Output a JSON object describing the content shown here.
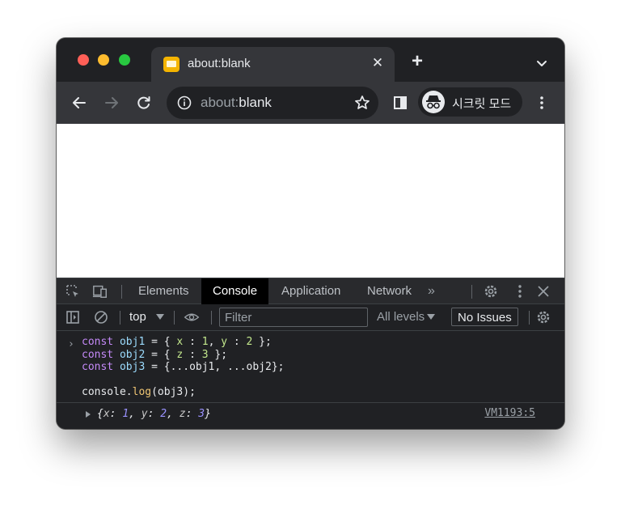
{
  "tab": {
    "title": "about:blank",
    "close_glyph": "✕",
    "new_tab_glyph": "+"
  },
  "omnibox": {
    "scheme": "about:",
    "host": "blank"
  },
  "profile": {
    "label": "시크릿 모드"
  },
  "devtools": {
    "tabs": [
      "Elements",
      "Console",
      "Application",
      "Network"
    ],
    "active_tab": "Console",
    "more_glyph": "»",
    "context": "top",
    "filter_placeholder": "Filter",
    "levels": "All levels",
    "issues": "No Issues"
  },
  "console": {
    "input_lines": [
      "const obj1 = { x : 1, y : 2 };",
      "const obj2 = { z : 3 };",
      "const obj3 = {...obj1, ...obj2};",
      "",
      "console.log(obj3);"
    ],
    "output": "{x: 1, y: 2, z: 3}",
    "source_link": "VM1193:5"
  },
  "colors": {
    "keyword": "#c58af9",
    "variable": "#9cdcfe",
    "number": "#c3e88d",
    "page_background": "#ffffff"
  }
}
